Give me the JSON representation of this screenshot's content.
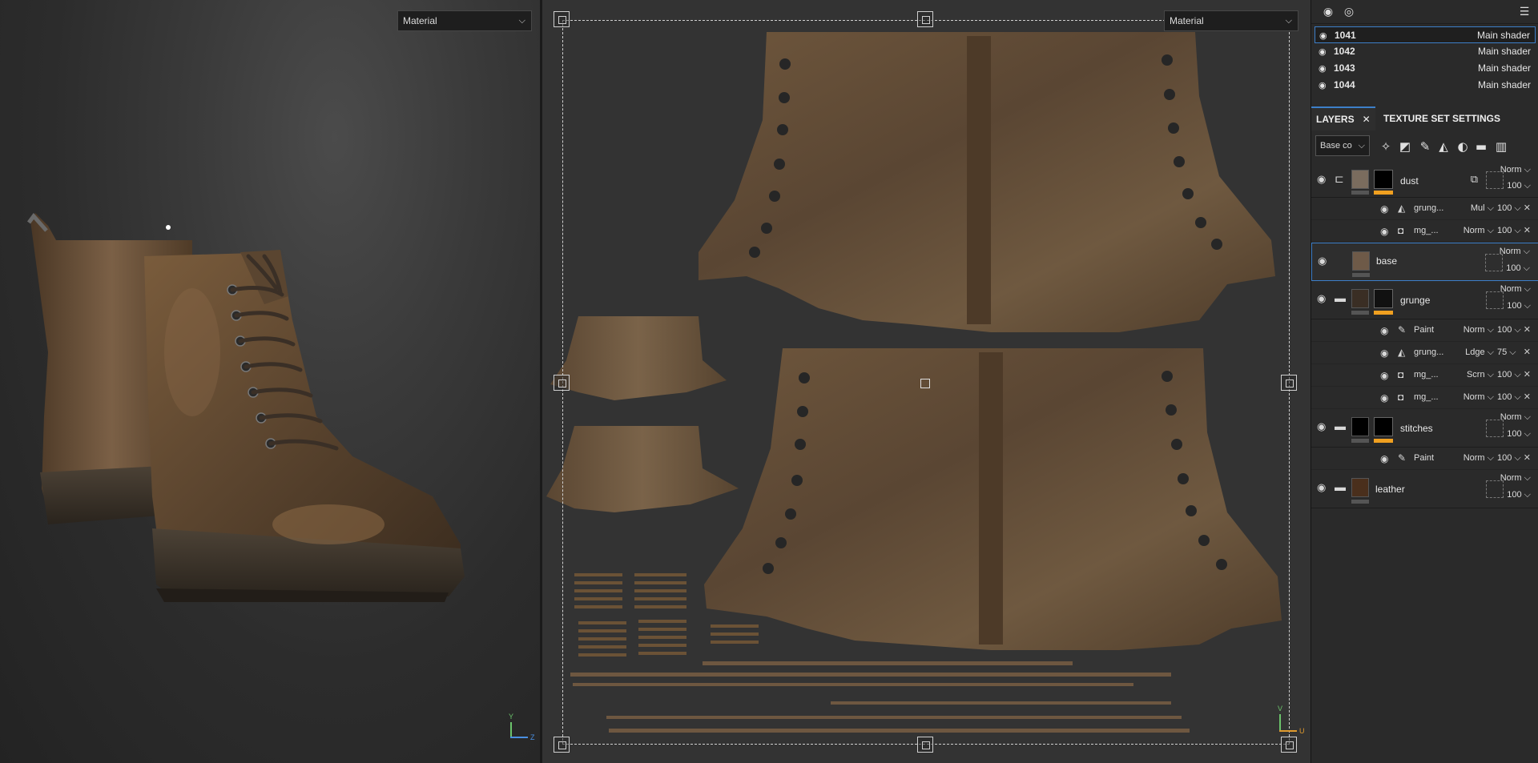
{
  "viewport3d": {
    "channel": "Material",
    "axis_y": "Y",
    "axis_z": "Z"
  },
  "viewport2d": {
    "channel": "Material",
    "axis_v": "V",
    "axis_u": "U"
  },
  "texture_sets": [
    {
      "name": "1041",
      "shader": "Main shader"
    },
    {
      "name": "1042",
      "shader": "Main shader"
    },
    {
      "name": "1043",
      "shader": "Main shader"
    },
    {
      "name": "1044",
      "shader": "Main shader"
    }
  ],
  "tabs": {
    "layers": "LAYERS",
    "texture_set_settings": "TEXTURE SET SETTINGS",
    "close": "✕"
  },
  "toolbar": {
    "channel": "Base co"
  },
  "layers": [
    {
      "name": "dust",
      "blend": "Norm",
      "opacity": "100",
      "effects": [
        {
          "name": "grung...",
          "blend": "Mul",
          "opacity": "100"
        },
        {
          "name": "mg_...",
          "blend": "Norm",
          "opacity": "100"
        }
      ]
    },
    {
      "name": "base",
      "blend": "Norm",
      "opacity": "100"
    },
    {
      "name": "grunge",
      "blend": "Norm",
      "opacity": "100",
      "effects": [
        {
          "name": "Paint",
          "blend": "Norm",
          "opacity": "100"
        },
        {
          "name": "grung...",
          "blend": "Ldge",
          "opacity": "75"
        },
        {
          "name": "mg_...",
          "blend": "Scrn",
          "opacity": "100"
        },
        {
          "name": "mg_...",
          "blend": "Norm",
          "opacity": "100"
        }
      ]
    },
    {
      "name": "stitches",
      "blend": "Norm",
      "opacity": "100",
      "effects": [
        {
          "name": "Paint",
          "blend": "Norm",
          "opacity": "100"
        }
      ]
    },
    {
      "name": "leather",
      "blend": "Norm",
      "opacity": "100"
    }
  ],
  "colors": {
    "accent": "#3d7fc9",
    "mask_bar": "#f0a020",
    "leather": "#6b5236"
  }
}
